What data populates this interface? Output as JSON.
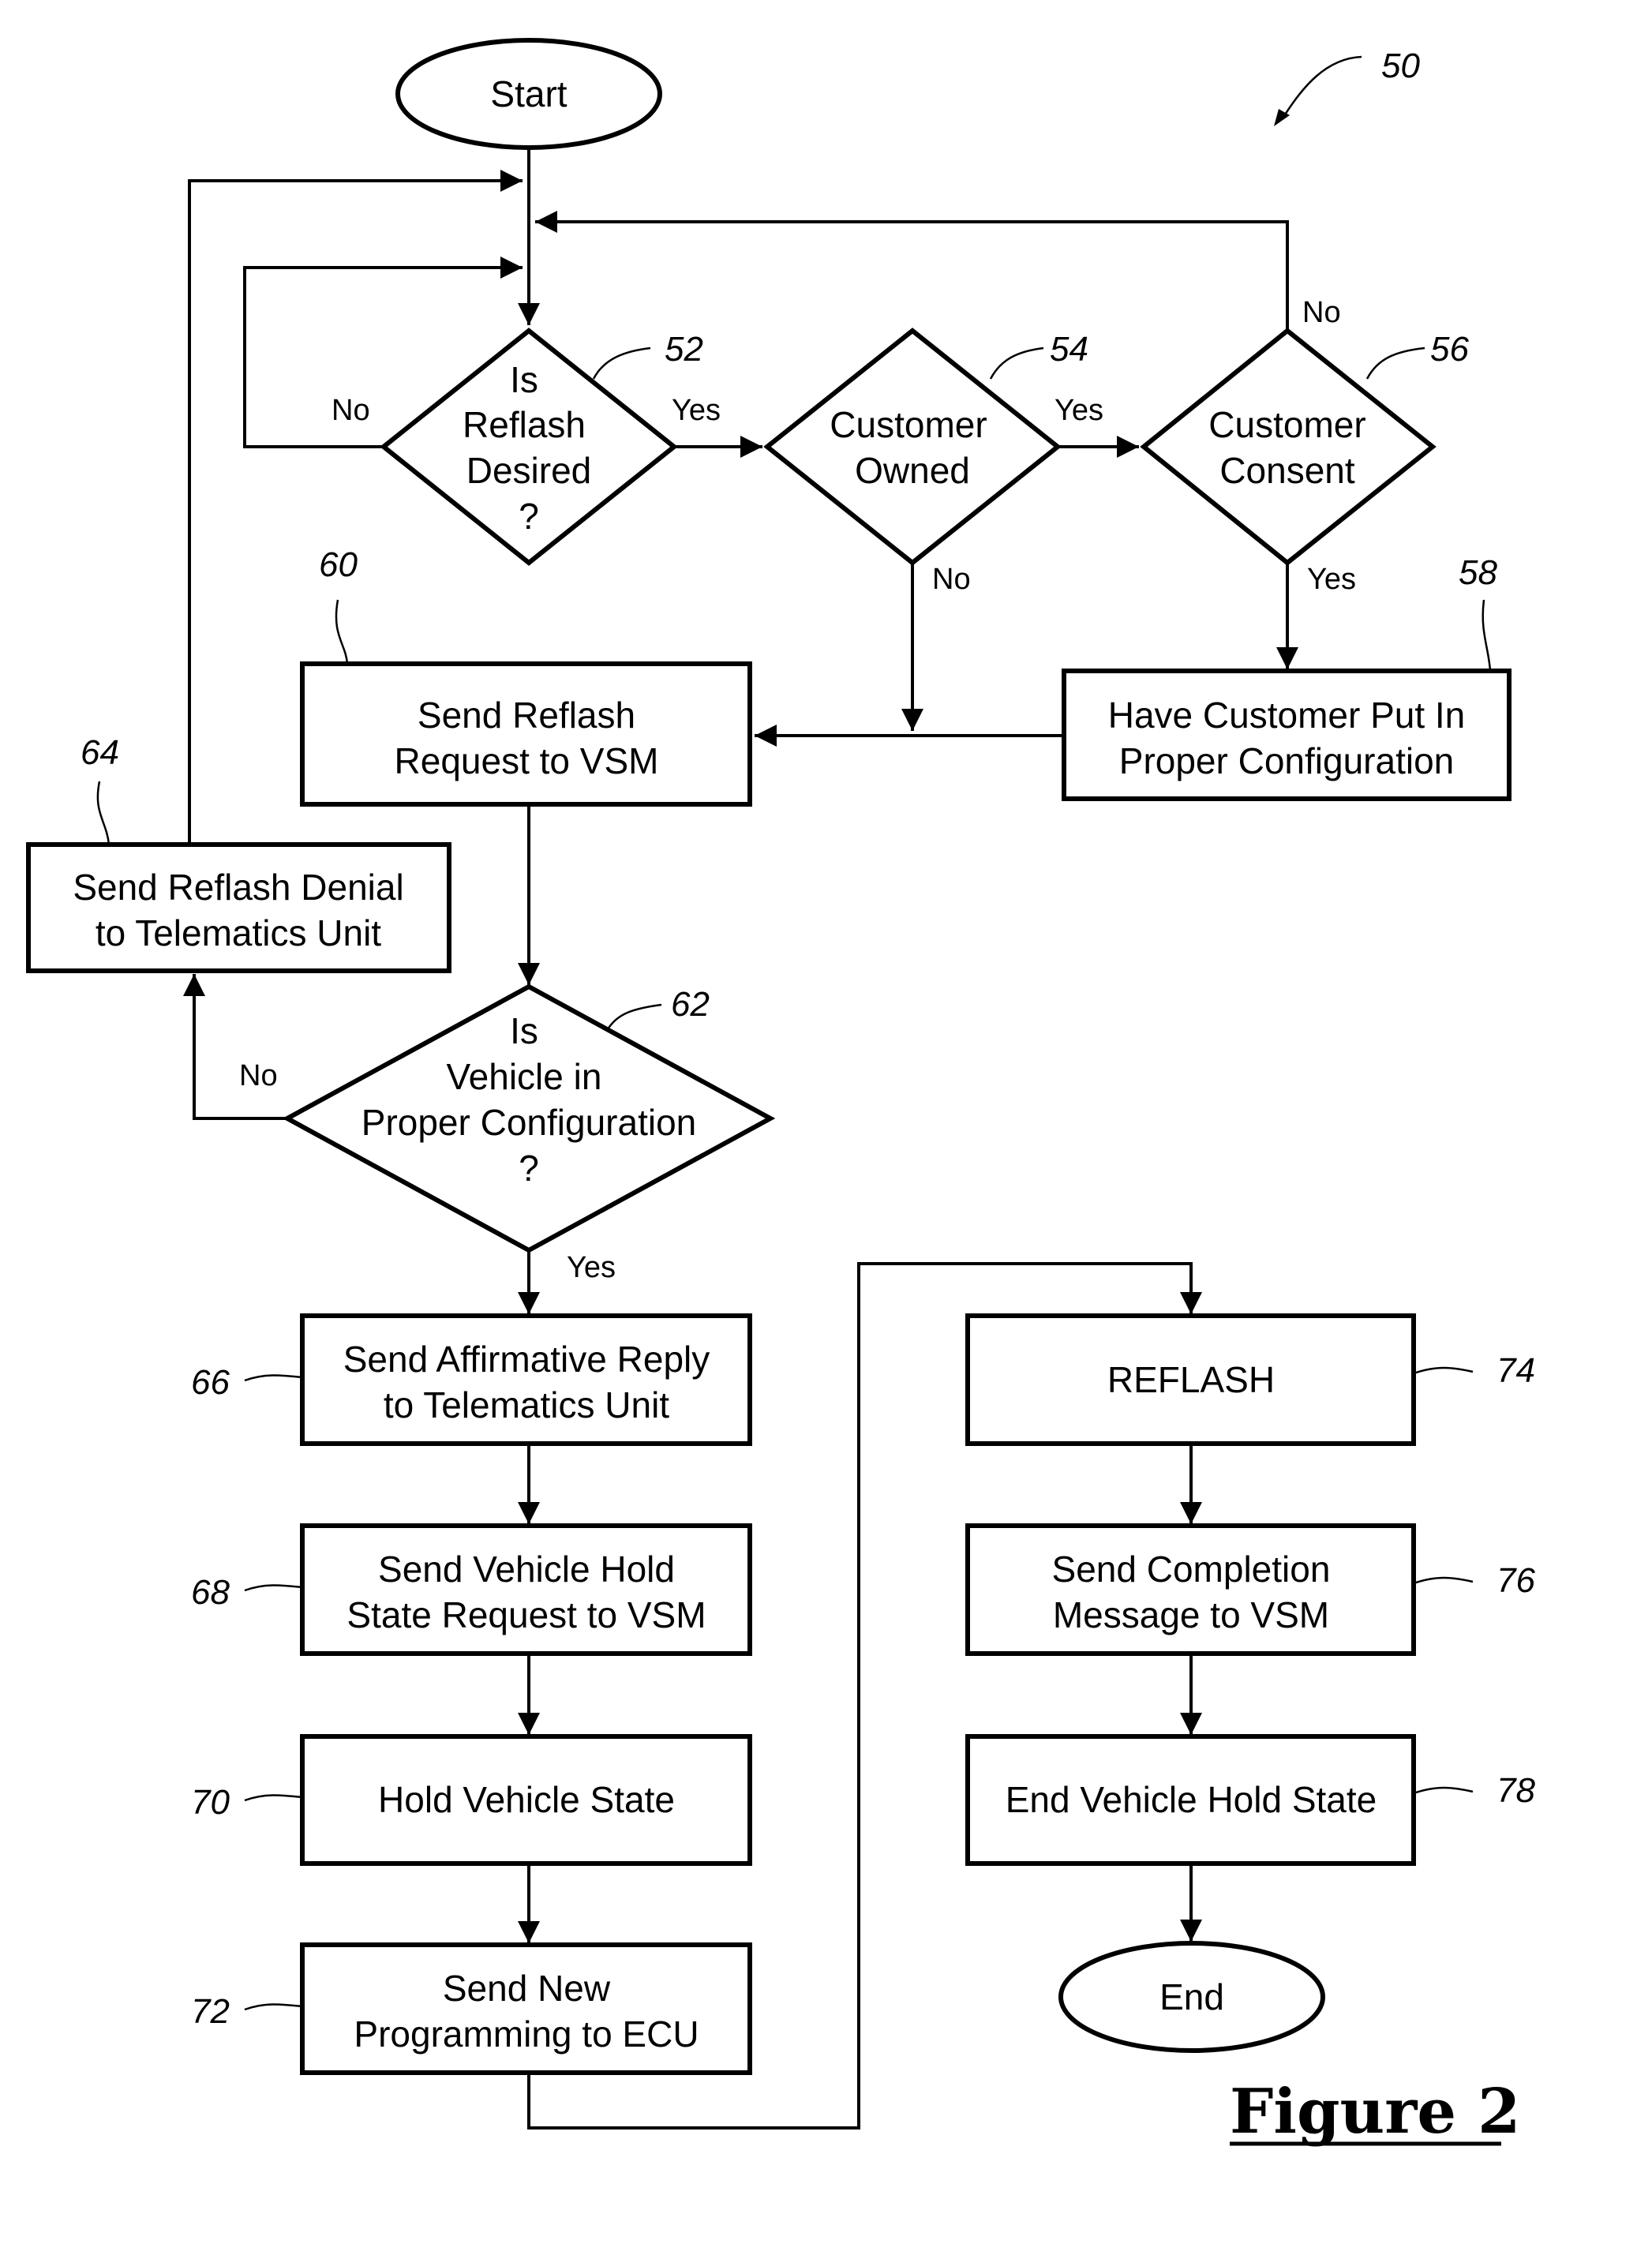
{
  "figure": {
    "title": "Figure 2",
    "reference": "50"
  },
  "nodes": {
    "start": {
      "type": "terminal",
      "lines": [
        "Start"
      ]
    },
    "n52": {
      "type": "decision",
      "ref": "52",
      "lines": [
        "Is",
        "Reflash",
        "Desired",
        "?"
      ]
    },
    "n54": {
      "type": "decision",
      "ref": "54",
      "lines": [
        "Customer",
        "Owned"
      ]
    },
    "n56": {
      "type": "decision",
      "ref": "56",
      "lines": [
        "Customer",
        "Consent"
      ]
    },
    "n58": {
      "type": "process",
      "ref": "58",
      "lines": [
        "Have Customer Put In",
        "Proper Configuration"
      ]
    },
    "n60": {
      "type": "process",
      "ref": "60",
      "lines": [
        "Send Reflash",
        "Request to VSM"
      ]
    },
    "n62": {
      "type": "decision",
      "ref": "62",
      "lines": [
        "Is",
        "Vehicle in",
        "Proper Configuration",
        "?"
      ]
    },
    "n64": {
      "type": "process",
      "ref": "64",
      "lines": [
        "Send Reflash Denial",
        "to Telematics Unit"
      ]
    },
    "n66": {
      "type": "process",
      "ref": "66",
      "lines": [
        "Send Affirmative Reply",
        "to Telematics Unit"
      ]
    },
    "n68": {
      "type": "process",
      "ref": "68",
      "lines": [
        "Send Vehicle Hold",
        "State Request to VSM"
      ]
    },
    "n70": {
      "type": "process",
      "ref": "70",
      "lines": [
        "Hold Vehicle State"
      ]
    },
    "n72": {
      "type": "process",
      "ref": "72",
      "lines": [
        "Send New",
        "Programming to ECU"
      ]
    },
    "n74": {
      "type": "process",
      "ref": "74",
      "lines": [
        "REFLASH"
      ]
    },
    "n76": {
      "type": "process",
      "ref": "76",
      "lines": [
        "Send Completion",
        "Message to VSM"
      ]
    },
    "n78": {
      "type": "process",
      "ref": "78",
      "lines": [
        "End Vehicle Hold State"
      ]
    },
    "end": {
      "type": "terminal",
      "lines": [
        "End"
      ]
    }
  },
  "edges": [
    {
      "from": "start",
      "to": "n52",
      "label": ""
    },
    {
      "from": "n52",
      "to": "n52",
      "label": "No"
    },
    {
      "from": "n52",
      "to": "n54",
      "label": "Yes"
    },
    {
      "from": "n54",
      "to": "n56",
      "label": "Yes"
    },
    {
      "from": "n54",
      "to": "n60",
      "label": "No"
    },
    {
      "from": "n56",
      "to": "n52",
      "label": "No"
    },
    {
      "from": "n56",
      "to": "n58",
      "label": "Yes"
    },
    {
      "from": "n58",
      "to": "n60",
      "label": ""
    },
    {
      "from": "n60",
      "to": "n62",
      "label": ""
    },
    {
      "from": "n62",
      "to": "n64",
      "label": "No"
    },
    {
      "from": "n62",
      "to": "n66",
      "label": "Yes"
    },
    {
      "from": "n64",
      "to": "n52",
      "label": ""
    },
    {
      "from": "n66",
      "to": "n68",
      "label": ""
    },
    {
      "from": "n68",
      "to": "n70",
      "label": ""
    },
    {
      "from": "n70",
      "to": "n72",
      "label": ""
    },
    {
      "from": "n72",
      "to": "n74",
      "label": ""
    },
    {
      "from": "n74",
      "to": "n76",
      "label": ""
    },
    {
      "from": "n76",
      "to": "n78",
      "label": ""
    },
    {
      "from": "n78",
      "to": "end",
      "label": ""
    }
  ],
  "edge_labels": {
    "n52_no": "No",
    "n52_yes": "Yes",
    "n54_yes": "Yes",
    "n54_no": "No",
    "n56_no": "No",
    "n56_yes": "Yes",
    "n62_no": "No",
    "n62_yes": "Yes"
  }
}
